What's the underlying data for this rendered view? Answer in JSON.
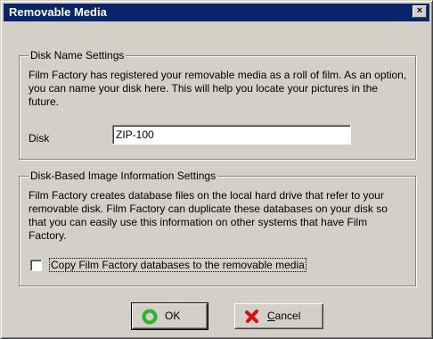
{
  "window": {
    "title": "Removable Media",
    "close_glyph": "×"
  },
  "disk_group": {
    "legend": "Disk Name Settings",
    "description": "Film Factory has registered your removable media as a roll of film.  As an option, you can name your disk here.  This will help you locate your pictures in the future.",
    "disk_label": "Disk",
    "disk_value": "ZIP-100"
  },
  "info_group": {
    "legend": "Disk-Based Image Information Settings",
    "description": "Film Factory creates database files on the local hard drive that refer to your removable disk.  Film Factory can duplicate these databases on your disk so that you can easily use this information on other systems that have Film Factory.",
    "checkbox_label": "Copy Film Factory databases to the removable media",
    "checkbox_checked": false
  },
  "buttons": {
    "ok_label": "OK",
    "cancel_label_first": "C",
    "cancel_label_rest": "ancel"
  },
  "icons": {
    "ok_icon": "green-circle-icon",
    "cancel_icon": "red-x-icon"
  },
  "colors": {
    "title_bar": "#0a246a",
    "face": "#d4d0c8",
    "ok_icon": "#2db52d",
    "cancel_icon": "#d61010"
  }
}
